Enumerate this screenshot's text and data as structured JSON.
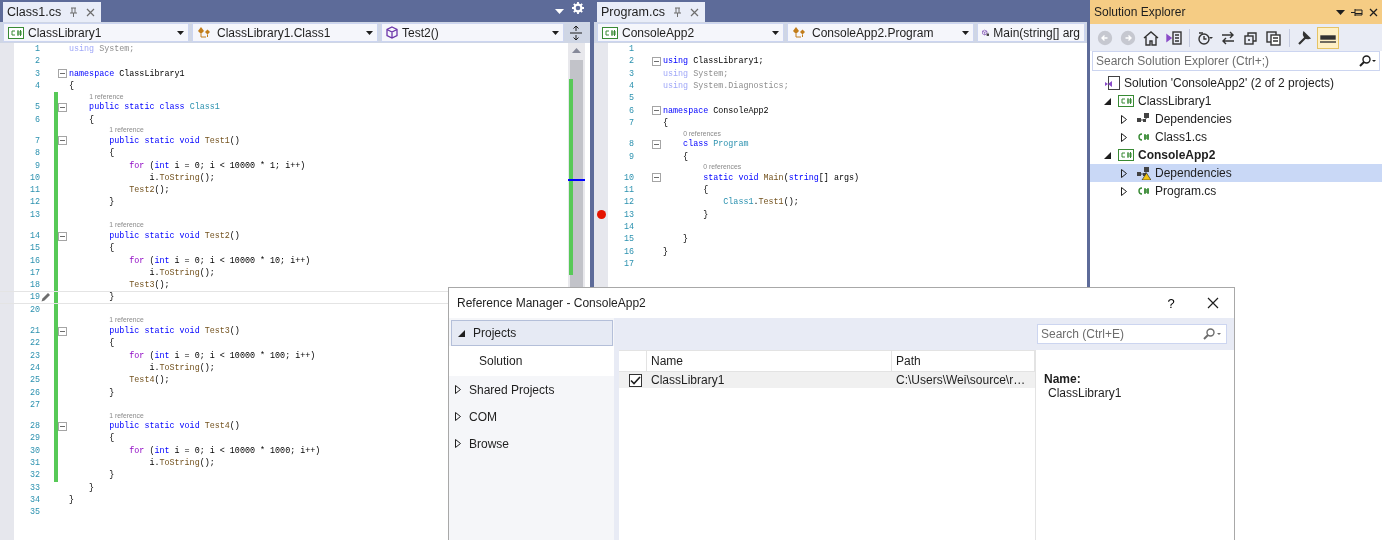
{
  "editors": [
    {
      "tab": {
        "title": "Class1.cs"
      },
      "tab_menu": true,
      "split_button": true,
      "scrollbar": true,
      "nav": [
        {
          "kind": "project",
          "text": "ClassLibrary1",
          "caret": true
        },
        {
          "kind": "class",
          "text": "ClassLibrary1.Class1",
          "caret": true
        },
        {
          "kind": "method",
          "text": "Test2()",
          "caret": true
        }
      ],
      "lines": [
        {
          "number": "1",
          "fold": false,
          "changed": false,
          "current": false,
          "tokens": [
            {
              "kind": "dkw",
              "text": "using"
            },
            {
              "kind": "dim",
              "text": " System;"
            }
          ]
        },
        {
          "number": "2",
          "fold": false,
          "changed": false,
          "current": false
        },
        {
          "number": "3",
          "fold": true,
          "changed": false,
          "current": false,
          "tokens": [
            {
              "kind": "kw",
              "text": "namespace"
            },
            {
              "kind": "p",
              "text": " ClassLibrary1"
            }
          ]
        },
        {
          "number": "4",
          "fold": false,
          "changed": false,
          "current": false,
          "tokens": [
            {
              "kind": "p",
              "text": "{"
            }
          ]
        },
        {
          "number": "5",
          "fold": true,
          "changed": true,
          "current": false,
          "codelens": "1 reference",
          "tokens": [
            {
              "kind": "kw",
              "text": "    public static class "
            },
            {
              "kind": "type",
              "text": "Class1"
            }
          ]
        },
        {
          "number": "6",
          "fold": false,
          "changed": true,
          "current": false,
          "tokens": [
            {
              "kind": "p",
              "text": "    {"
            }
          ]
        },
        {
          "number": "7",
          "fold": true,
          "changed": true,
          "current": false,
          "codelens": "1 reference",
          "tokens": [
            {
              "kind": "kw",
              "text": "        public static void "
            },
            {
              "kind": "fn",
              "text": "Test1"
            },
            {
              "kind": "p",
              "text": "()"
            }
          ]
        },
        {
          "number": "8",
          "fold": false,
          "changed": true,
          "current": false,
          "tokens": [
            {
              "kind": "p",
              "text": "        {"
            }
          ]
        },
        {
          "number": "9",
          "fold": false,
          "changed": true,
          "current": false,
          "tokens": [
            {
              "kind": "ctl",
              "text": "            for"
            },
            {
              "kind": "p",
              "text": " ("
            },
            {
              "kind": "kw",
              "text": "int"
            },
            {
              "kind": "p",
              "text": " i = 0; i < 10000 * 1; i++)"
            }
          ]
        },
        {
          "number": "10",
          "fold": false,
          "changed": true,
          "current": false,
          "tokens": [
            {
              "kind": "p",
              "text": "                i."
            },
            {
              "kind": "fn",
              "text": "ToString"
            },
            {
              "kind": "p",
              "text": "();"
            }
          ]
        },
        {
          "number": "11",
          "fold": false,
          "changed": true,
          "current": false,
          "tokens": [
            {
              "kind": "fn",
              "text": "            Test2"
            },
            {
              "kind": "p",
              "text": "();"
            }
          ]
        },
        {
          "number": "12",
          "fold": false,
          "changed": true,
          "current": false,
          "tokens": [
            {
              "kind": "p",
              "text": "        }"
            }
          ]
        },
        {
          "number": "13",
          "fold": false,
          "changed": true,
          "current": false
        },
        {
          "number": "14",
          "fold": true,
          "changed": true,
          "current": false,
          "codelens": "1 reference",
          "tokens": [
            {
              "kind": "kw",
              "text": "        public static void "
            },
            {
              "kind": "fn",
              "text": "Test2"
            },
            {
              "kind": "p",
              "text": "()"
            }
          ]
        },
        {
          "number": "15",
          "fold": false,
          "changed": true,
          "current": false,
          "tokens": [
            {
              "kind": "p",
              "text": "        {"
            }
          ]
        },
        {
          "number": "16",
          "fold": false,
          "changed": true,
          "current": false,
          "tokens": [
            {
              "kind": "ctl",
              "text": "            for"
            },
            {
              "kind": "p",
              "text": " ("
            },
            {
              "kind": "kw",
              "text": "int"
            },
            {
              "kind": "p",
              "text": " i = 0; i < 10000 * 10; i++)"
            }
          ]
        },
        {
          "number": "17",
          "fold": false,
          "changed": true,
          "current": false,
          "tokens": [
            {
              "kind": "p",
              "text": "                i."
            },
            {
              "kind": "fn",
              "text": "ToString"
            },
            {
              "kind": "p",
              "text": "();"
            }
          ]
        },
        {
          "number": "18",
          "fold": false,
          "changed": true,
          "current": false,
          "tokens": [
            {
              "kind": "fn",
              "text": "            Test3"
            },
            {
              "kind": "p",
              "text": "();"
            }
          ]
        },
        {
          "number": "19",
          "fold": false,
          "changed": true,
          "current": true,
          "tokens": [
            {
              "kind": "p",
              "text": "        }"
            }
          ]
        },
        {
          "number": "20",
          "fold": false,
          "changed": true,
          "current": false
        },
        {
          "number": "21",
          "fold": true,
          "changed": true,
          "current": false,
          "codelens": "1 reference",
          "tokens": [
            {
              "kind": "kw",
              "text": "        public static void "
            },
            {
              "kind": "fn",
              "text": "Test3"
            },
            {
              "kind": "p",
              "text": "()"
            }
          ]
        },
        {
          "number": "22",
          "fold": false,
          "changed": true,
          "current": false,
          "tokens": [
            {
              "kind": "p",
              "text": "        {"
            }
          ]
        },
        {
          "number": "23",
          "fold": false,
          "changed": true,
          "current": false,
          "tokens": [
            {
              "kind": "ctl",
              "text": "            for"
            },
            {
              "kind": "p",
              "text": " ("
            },
            {
              "kind": "kw",
              "text": "int"
            },
            {
              "kind": "p",
              "text": " i = 0; i < 10000 * 100; i++)"
            }
          ]
        },
        {
          "number": "24",
          "fold": false,
          "changed": true,
          "current": false,
          "tokens": [
            {
              "kind": "p",
              "text": "                i."
            },
            {
              "kind": "fn",
              "text": "ToString"
            },
            {
              "kind": "p",
              "text": "();"
            }
          ]
        },
        {
          "number": "25",
          "fold": false,
          "changed": true,
          "current": false,
          "tokens": [
            {
              "kind": "fn",
              "text": "            Test4"
            },
            {
              "kind": "p",
              "text": "();"
            }
          ]
        },
        {
          "number": "26",
          "fold": false,
          "changed": true,
          "current": false,
          "tokens": [
            {
              "kind": "p",
              "text": "        }"
            }
          ]
        },
        {
          "number": "27",
          "fold": false,
          "changed": true,
          "current": false
        },
        {
          "number": "28",
          "fold": true,
          "changed": true,
          "current": false,
          "codelens": "1 reference",
          "tokens": [
            {
              "kind": "kw",
              "text": "        public static void "
            },
            {
              "kind": "fn",
              "text": "Test4"
            },
            {
              "kind": "p",
              "text": "()"
            }
          ]
        },
        {
          "number": "29",
          "fold": false,
          "changed": true,
          "current": false,
          "tokens": [
            {
              "kind": "p",
              "text": "        {"
            }
          ]
        },
        {
          "number": "30",
          "fold": false,
          "changed": true,
          "current": false,
          "tokens": [
            {
              "kind": "ctl",
              "text": "            for"
            },
            {
              "kind": "p",
              "text": " ("
            },
            {
              "kind": "kw",
              "text": "int"
            },
            {
              "kind": "p",
              "text": " i = 0; i < 10000 * 1000; i++)"
            }
          ]
        },
        {
          "number": "31",
          "fold": false,
          "changed": true,
          "current": false,
          "tokens": [
            {
              "kind": "p",
              "text": "                i."
            },
            {
              "kind": "fn",
              "text": "ToString"
            },
            {
              "kind": "p",
              "text": "();"
            }
          ]
        },
        {
          "number": "32",
          "fold": false,
          "changed": true,
          "current": false,
          "tokens": [
            {
              "kind": "p",
              "text": "        }"
            }
          ]
        },
        {
          "number": "33",
          "fold": false,
          "changed": false,
          "current": false,
          "tokens": [
            {
              "kind": "p",
              "text": "    }"
            }
          ]
        },
        {
          "number": "34",
          "fold": false,
          "changed": false,
          "current": false,
          "tokens": [
            {
              "kind": "p",
              "text": "}"
            }
          ]
        },
        {
          "number": "35",
          "fold": false,
          "changed": false,
          "current": false
        }
      ]
    },
    {
      "tab": {
        "title": "Program.cs"
      },
      "tab_menu": false,
      "split_button": false,
      "scrollbar": false,
      "nav": [
        {
          "kind": "project",
          "text": "ConsoleApp2",
          "caret": true
        },
        {
          "kind": "class",
          "text": "ConsoleApp2.Program",
          "caret": true
        },
        {
          "kind": "private-method",
          "text": "Main(string[] arg",
          "caret": false
        }
      ],
      "lines": [
        {
          "number": "1",
          "fold": false,
          "breakpoint": false
        },
        {
          "number": "2",
          "fold": true,
          "breakpoint": false,
          "tokens": [
            {
              "kind": "kw",
              "text": "using"
            },
            {
              "kind": "p",
              "text": " ClassLibrary1;"
            }
          ]
        },
        {
          "number": "3",
          "fold": false,
          "breakpoint": false,
          "tokens": [
            {
              "kind": "dkw",
              "text": "using"
            },
            {
              "kind": "dim",
              "text": " System;"
            }
          ]
        },
        {
          "number": "4",
          "fold": false,
          "breakpoint": false,
          "tokens": [
            {
              "kind": "dkw",
              "text": "using"
            },
            {
              "kind": "dim",
              "text": " System.Diagnostics;"
            }
          ]
        },
        {
          "number": "5",
          "fold": false,
          "breakpoint": false
        },
        {
          "number": "6",
          "fold": true,
          "breakpoint": false,
          "tokens": [
            {
              "kind": "kw",
              "text": "namespace"
            },
            {
              "kind": "p",
              "text": " ConsoleApp2"
            }
          ]
        },
        {
          "number": "7",
          "fold": false,
          "breakpoint": false,
          "tokens": [
            {
              "kind": "p",
              "text": "{"
            }
          ]
        },
        {
          "number": "8",
          "fold": true,
          "breakpoint": false,
          "codelens": "0 references",
          "tokens": [
            {
              "kind": "kw",
              "text": "    class "
            },
            {
              "kind": "type",
              "text": "Program"
            }
          ]
        },
        {
          "number": "9",
          "fold": false,
          "breakpoint": false,
          "tokens": [
            {
              "kind": "p",
              "text": "    {"
            }
          ]
        },
        {
          "number": "10",
          "fold": true,
          "breakpoint": false,
          "codelens": "0 references",
          "tokens": [
            {
              "kind": "kw",
              "text": "        static void "
            },
            {
              "kind": "fn",
              "text": "Main"
            },
            {
              "kind": "p",
              "text": "("
            },
            {
              "kind": "kw",
              "text": "string"
            },
            {
              "kind": "p",
              "text": "[] args)"
            }
          ]
        },
        {
          "number": "11",
          "fold": false,
          "breakpoint": false,
          "tokens": [
            {
              "kind": "p",
              "text": "        {"
            }
          ]
        },
        {
          "number": "12",
          "fold": false,
          "breakpoint": false,
          "tokens": [
            {
              "kind": "type",
              "text": "            Class1"
            },
            {
              "kind": "p",
              "text": "."
            },
            {
              "kind": "fn",
              "text": "Test1"
            },
            {
              "kind": "p",
              "text": "();"
            }
          ]
        },
        {
          "number": "13",
          "fold": false,
          "breakpoint": true,
          "tokens": [
            {
              "kind": "p",
              "text": "        }"
            }
          ]
        },
        {
          "number": "14",
          "fold": false,
          "breakpoint": false
        },
        {
          "number": "15",
          "fold": false,
          "breakpoint": false,
          "tokens": [
            {
              "kind": "p",
              "text": "    }"
            }
          ]
        },
        {
          "number": "16",
          "fold": false,
          "breakpoint": false,
          "tokens": [
            {
              "kind": "p",
              "text": "}"
            }
          ]
        },
        {
          "number": "17",
          "fold": false,
          "breakpoint": false
        }
      ]
    }
  ],
  "solution_explorer": {
    "title": "Solution Explorer",
    "toolbar": [
      [
        {
          "kind": "back",
          "disabled": true,
          "selected": false
        },
        {
          "kind": "forward",
          "disabled": true,
          "selected": false
        },
        {
          "kind": "home",
          "disabled": false,
          "selected": false
        },
        {
          "kind": "switch-views",
          "disabled": false,
          "selected": false
        }
      ],
      [
        {
          "kind": "pending-changes",
          "disabled": false,
          "selected": false
        },
        {
          "kind": "sync",
          "disabled": false,
          "selected": false
        },
        {
          "kind": "collapse-all",
          "disabled": false,
          "selected": false
        },
        {
          "kind": "show-all-files",
          "disabled": false,
          "selected": false
        }
      ],
      [
        {
          "kind": "properties",
          "disabled": false,
          "selected": false
        },
        {
          "kind": "preview",
          "disabled": false,
          "selected": true
        }
      ]
    ],
    "search": {
      "placeholder": "Search Solution Explorer (Ctrl+;)"
    },
    "tree": [
      {
        "kind": "solution",
        "label": "Solution 'ConsoleApp2' (2 of 2 projects)",
        "selected": false,
        "children": [
          {
            "kind": "project",
            "label": "ClassLibrary1",
            "expanded": true,
            "startup": false,
            "selected": false,
            "children": [
              {
                "kind": "dependencies",
                "label": "Dependencies",
                "expanded": false,
                "warning": false,
                "selected": false
              },
              {
                "kind": "file",
                "label": "Class1.cs",
                "expanded": false,
                "selected": false
              }
            ]
          },
          {
            "kind": "project",
            "label": "ConsoleApp2",
            "expanded": true,
            "startup": true,
            "selected": false,
            "children": [
              {
                "kind": "dependencies",
                "label": "Dependencies",
                "expanded": false,
                "warning": true,
                "selected": true
              },
              {
                "kind": "file",
                "label": "Program.cs",
                "expanded": false,
                "selected": false
              }
            ]
          }
        ]
      }
    ]
  },
  "reference_manager": {
    "title": "Reference Manager - ConsoleApp2",
    "help": "?",
    "categories": [
      {
        "label": "Projects",
        "expanded": true,
        "selected": false,
        "children": [
          {
            "label": "Solution",
            "selected": true
          }
        ]
      },
      {
        "label": "Shared Projects",
        "expanded": false,
        "selected": false
      },
      {
        "label": "COM",
        "expanded": false,
        "selected": false
      },
      {
        "label": "Browse",
        "expanded": false,
        "selected": false
      }
    ],
    "search": {
      "placeholder": "Search (Ctrl+E)"
    },
    "table": {
      "columns": [
        "Name",
        "Path"
      ],
      "rows": [
        {
          "checked": true,
          "selected": true,
          "cells": [
            "ClassLibrary1",
            "C:\\Users\\Wei\\source\\r…"
          ]
        }
      ]
    },
    "details": {
      "label": "Name:",
      "value": "ClassLibrary1"
    }
  }
}
